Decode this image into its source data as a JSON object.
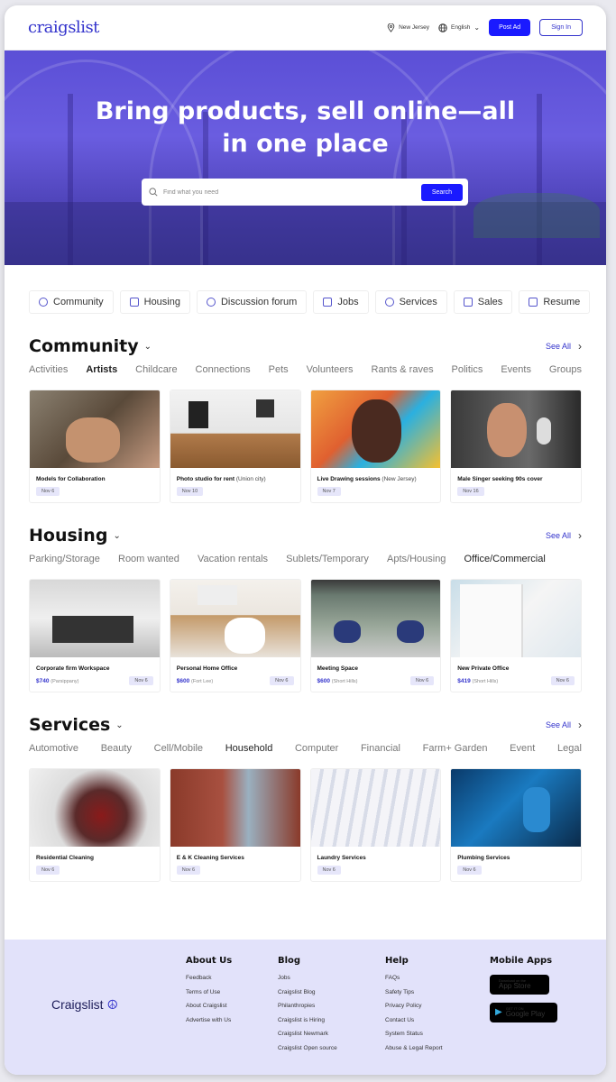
{
  "header": {
    "logo": "craigslist",
    "location": "New Jersey",
    "language": "English",
    "post_ad": "Post Ad",
    "sign_in": "Sign In"
  },
  "hero": {
    "title_line1": "Bring products, sell online—all",
    "title_line2": "in one place",
    "search_placeholder": "Find what you need",
    "search_button": "Search"
  },
  "categories": [
    "Community",
    "Housing",
    "Discussion forum",
    "Jobs",
    "Services",
    "Sales",
    "Resume"
  ],
  "see_all": "See All",
  "community": {
    "title": "Community",
    "subcats": [
      "Activities",
      "Artists",
      "Childcare",
      "Connections",
      "Pets",
      "Volunteers",
      "Rants & raves",
      "Politics",
      "Events",
      "Groups"
    ],
    "cards": [
      {
        "title": "Models for Collaboration",
        "loc": "",
        "date": "Nov 6"
      },
      {
        "title": "Photo studio for rent",
        "loc": "(Union city)",
        "date": "Nov 10"
      },
      {
        "title": "Live Drawing sessions",
        "loc": "(New Jersey)",
        "date": "Nov 7"
      },
      {
        "title": "Male Singer seeking 90s cover",
        "loc": "",
        "date": "Nov 16"
      }
    ]
  },
  "housing": {
    "title": "Housing",
    "subcats": [
      "Parking/Storage",
      "Room wanted",
      "Vacation rentals",
      "Sublets/Temporary",
      "Apts/Housing",
      "Office/Commercial"
    ],
    "cards": [
      {
        "title": "Corporate firm Workspace",
        "price": "$740",
        "loc": "(Parsippany)",
        "date": "Nov 6"
      },
      {
        "title": "Personal Home Office",
        "price": "$600",
        "loc": "(Fort Lee)",
        "date": "Nov 6"
      },
      {
        "title": "Meeting Space",
        "price": "$600",
        "loc": "(Short Hills)",
        "date": "Nov 6"
      },
      {
        "title": "New Private Office",
        "price": "$419",
        "loc": "(Short Hills)",
        "date": "Nov 6"
      }
    ]
  },
  "services": {
    "title": "Services",
    "subcats": [
      "Automotive",
      "Beauty",
      "Cell/Mobile",
      "Household",
      "Computer",
      "Financial",
      "Farm+ Garden",
      "Event",
      "Legal"
    ],
    "cards": [
      {
        "title": "Residential Cleaning",
        "date": "Nov 6"
      },
      {
        "title": "E & K Cleaning Services",
        "date": "Nov 6"
      },
      {
        "title": "Laundry Services",
        "date": "Nov 6"
      },
      {
        "title": "Plumbing Services",
        "date": "Nov 6"
      }
    ]
  },
  "footer": {
    "logo": "Craigslist",
    "about": {
      "title": "About Us",
      "links": [
        "Feedback",
        "Terms of Use",
        "About Craigslist",
        "Advertise with Us"
      ]
    },
    "blog": {
      "title": "Blog",
      "links": [
        "Jobs",
        "Craigslist Blog",
        "Philanthropies",
        "Craigslist is Hiring",
        "Craigslist Newmark",
        "Craigslist Open source"
      ]
    },
    "help": {
      "title": "Help",
      "links": [
        "FAQs",
        "Safety Tips",
        "Privacy Policy",
        "Contact Us",
        "System Status",
        "Abuse & Legal Report"
      ]
    },
    "apps": {
      "title": "Mobile Apps",
      "appstore_small": "Download on the",
      "appstore_big": "App Store",
      "play_small": "GET IT ON",
      "play_big": "Google Play"
    }
  }
}
